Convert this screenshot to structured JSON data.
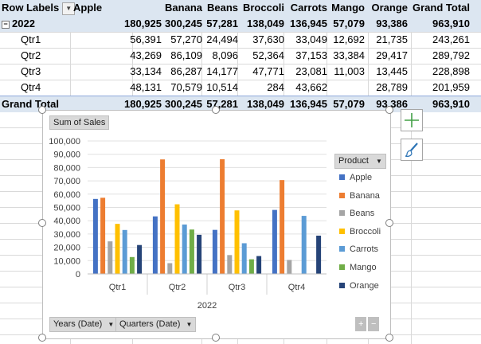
{
  "pivot": {
    "headers": [
      "Row Labels",
      "Apple",
      "Banana",
      "Beans",
      "Broccoli",
      "Carrots",
      "Mango",
      "Orange",
      "Grand Total"
    ],
    "rows": [
      {
        "label": "2022",
        "kind": "year",
        "values": [
          "180,925",
          "300,245",
          "57,281",
          "138,049",
          "136,945",
          "57,079",
          "93,386",
          "963,910"
        ]
      },
      {
        "label": "Qtr1",
        "kind": "quarter",
        "values": [
          "56,391",
          "57,270",
          "24,494",
          "37,630",
          "33,049",
          "12,692",
          "21,735",
          "243,261"
        ]
      },
      {
        "label": "Qtr2",
        "kind": "quarter",
        "values": [
          "43,269",
          "86,109",
          "8,096",
          "52,364",
          "37,153",
          "33,384",
          "29,417",
          "289,792"
        ]
      },
      {
        "label": "Qtr3",
        "kind": "quarter",
        "values": [
          "33,134",
          "86,287",
          "14,177",
          "47,771",
          "23,081",
          "11,003",
          "13,445",
          "228,898"
        ]
      },
      {
        "label": "Qtr4",
        "kind": "quarter",
        "values": [
          "48,131",
          "70,579",
          "10,514",
          "284",
          "43,662",
          "",
          "28,789",
          "201,959"
        ]
      },
      {
        "label": "Grand Total",
        "kind": "total",
        "values": [
          "180,925",
          "300,245",
          "57,281",
          "138,049",
          "136,945",
          "57,079",
          "93,386",
          "963,910"
        ]
      }
    ]
  },
  "chart": {
    "value_button": "Sum of Sales",
    "legend_button": "Product",
    "axis_buttons": [
      "Years (Date)",
      "Quarters (Date)"
    ],
    "zoom_buttons": [
      "+",
      "−"
    ],
    "x_group_label": "2022"
  },
  "chart_data": {
    "type": "bar",
    "categories": [
      "Qtr1",
      "Qtr2",
      "Qtr3",
      "Qtr4"
    ],
    "ylim": [
      0,
      100000
    ],
    "yticks": [
      "0",
      "10,000",
      "20,000",
      "30,000",
      "40,000",
      "50,000",
      "60,000",
      "70,000",
      "80,000",
      "90,000",
      "100,000"
    ],
    "series": [
      {
        "name": "Apple",
        "color": "#4472c4",
        "values": [
          56391,
          43269,
          33134,
          48131
        ]
      },
      {
        "name": "Banana",
        "color": "#ed7d31",
        "values": [
          57270,
          86109,
          86287,
          70579
        ]
      },
      {
        "name": "Beans",
        "color": "#a5a5a5",
        "values": [
          24494,
          8096,
          14177,
          10514
        ]
      },
      {
        "name": "Broccoli",
        "color": "#ffc000",
        "values": [
          37630,
          52364,
          47771,
          284
        ]
      },
      {
        "name": "Carrots",
        "color": "#5b9bd5",
        "values": [
          33049,
          37153,
          23081,
          43662
        ]
      },
      {
        "name": "Mango",
        "color": "#70ad47",
        "values": [
          12692,
          33384,
          11003,
          0
        ]
      },
      {
        "name": "Orange",
        "color": "#264478",
        "values": [
          21735,
          29417,
          13445,
          28789
        ]
      }
    ]
  }
}
